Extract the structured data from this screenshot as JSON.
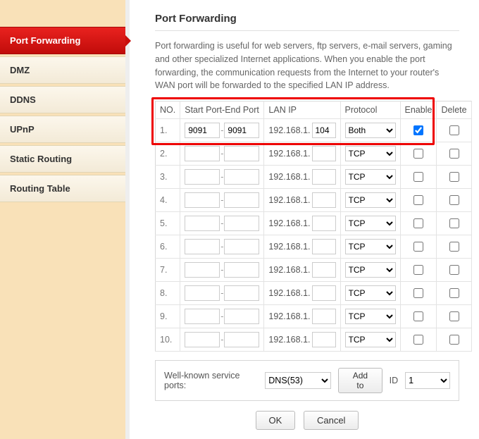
{
  "sidebar": {
    "items": [
      {
        "label": "Port Forwarding",
        "active": true
      },
      {
        "label": "DMZ",
        "active": false
      },
      {
        "label": "DDNS",
        "active": false
      },
      {
        "label": "UPnP",
        "active": false
      },
      {
        "label": "Static Routing",
        "active": false
      },
      {
        "label": "Routing Table",
        "active": false
      }
    ]
  },
  "page": {
    "title": "Port Forwarding",
    "intro": "Port forwarding is useful for web servers, ftp servers, e-mail servers, gaming and other specialized Internet applications. When you enable the port forwarding, the communication requests from the Internet to your router's WAN port will be forwarded to the specified LAN IP address."
  },
  "table": {
    "headers": {
      "no": "NO.",
      "ports": "Start Port-End Port",
      "lanip": "LAN IP",
      "protocol": "Protocol",
      "enable": "Enable",
      "delete": "Delete"
    },
    "lan_prefix": "192.168.1.",
    "rows": [
      {
        "no": "1.",
        "start": "9091",
        "end": "9091",
        "lan_last": "104",
        "protocol": "Both",
        "enable": true,
        "delete": false
      },
      {
        "no": "2.",
        "start": "",
        "end": "",
        "lan_last": "",
        "protocol": "TCP",
        "enable": false,
        "delete": false
      },
      {
        "no": "3.",
        "start": "",
        "end": "",
        "lan_last": "",
        "protocol": "TCP",
        "enable": false,
        "delete": false
      },
      {
        "no": "4.",
        "start": "",
        "end": "",
        "lan_last": "",
        "protocol": "TCP",
        "enable": false,
        "delete": false
      },
      {
        "no": "5.",
        "start": "",
        "end": "",
        "lan_last": "",
        "protocol": "TCP",
        "enable": false,
        "delete": false
      },
      {
        "no": "6.",
        "start": "",
        "end": "",
        "lan_last": "",
        "protocol": "TCP",
        "enable": false,
        "delete": false
      },
      {
        "no": "7.",
        "start": "",
        "end": "",
        "lan_last": "",
        "protocol": "TCP",
        "enable": false,
        "delete": false
      },
      {
        "no": "8.",
        "start": "",
        "end": "",
        "lan_last": "",
        "protocol": "TCP",
        "enable": false,
        "delete": false
      },
      {
        "no": "9.",
        "start": "",
        "end": "",
        "lan_last": "",
        "protocol": "TCP",
        "enable": false,
        "delete": false
      },
      {
        "no": "10.",
        "start": "",
        "end": "",
        "lan_last": "",
        "protocol": "TCP",
        "enable": false,
        "delete": false
      }
    ]
  },
  "wellknown": {
    "label": "Well-known service ports:",
    "service_selected": "DNS(53)",
    "add_label": "Add to",
    "id_label": "ID",
    "id_selected": "1"
  },
  "buttons": {
    "ok": "OK",
    "cancel": "Cancel"
  }
}
